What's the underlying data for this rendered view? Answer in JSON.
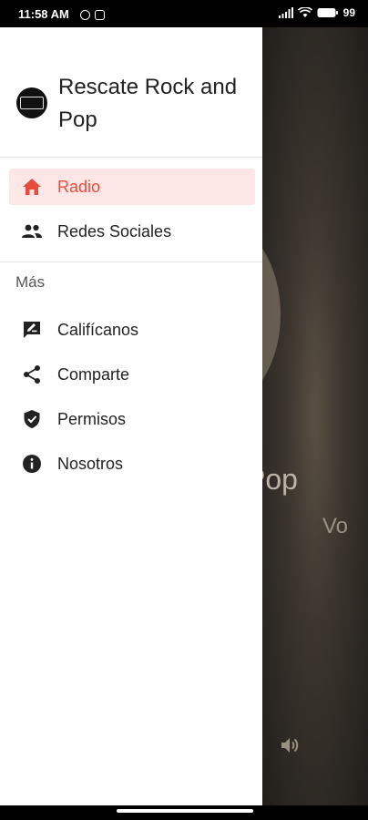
{
  "status": {
    "time": "11:58 AM",
    "battery": "99"
  },
  "app": {
    "title": "Rescate Rock and Pop"
  },
  "menu": {
    "primary": [
      {
        "label": "Radio",
        "icon": "home-icon"
      },
      {
        "label": "Redes Sociales",
        "icon": "people-icon"
      }
    ],
    "section_title": "Más",
    "secondary": [
      {
        "label": "Califícanos",
        "icon": "rate-review-icon"
      },
      {
        "label": "Comparte",
        "icon": "share-icon"
      },
      {
        "label": "Permisos",
        "icon": "shield-icon"
      },
      {
        "label": "Nosotros",
        "icon": "info-icon"
      }
    ]
  },
  "background": {
    "title_fragment": "Pop",
    "subtitle_fragment": "Vo"
  },
  "colors": {
    "accent": "#e74c3c",
    "active_bg": "#fde7e6"
  }
}
